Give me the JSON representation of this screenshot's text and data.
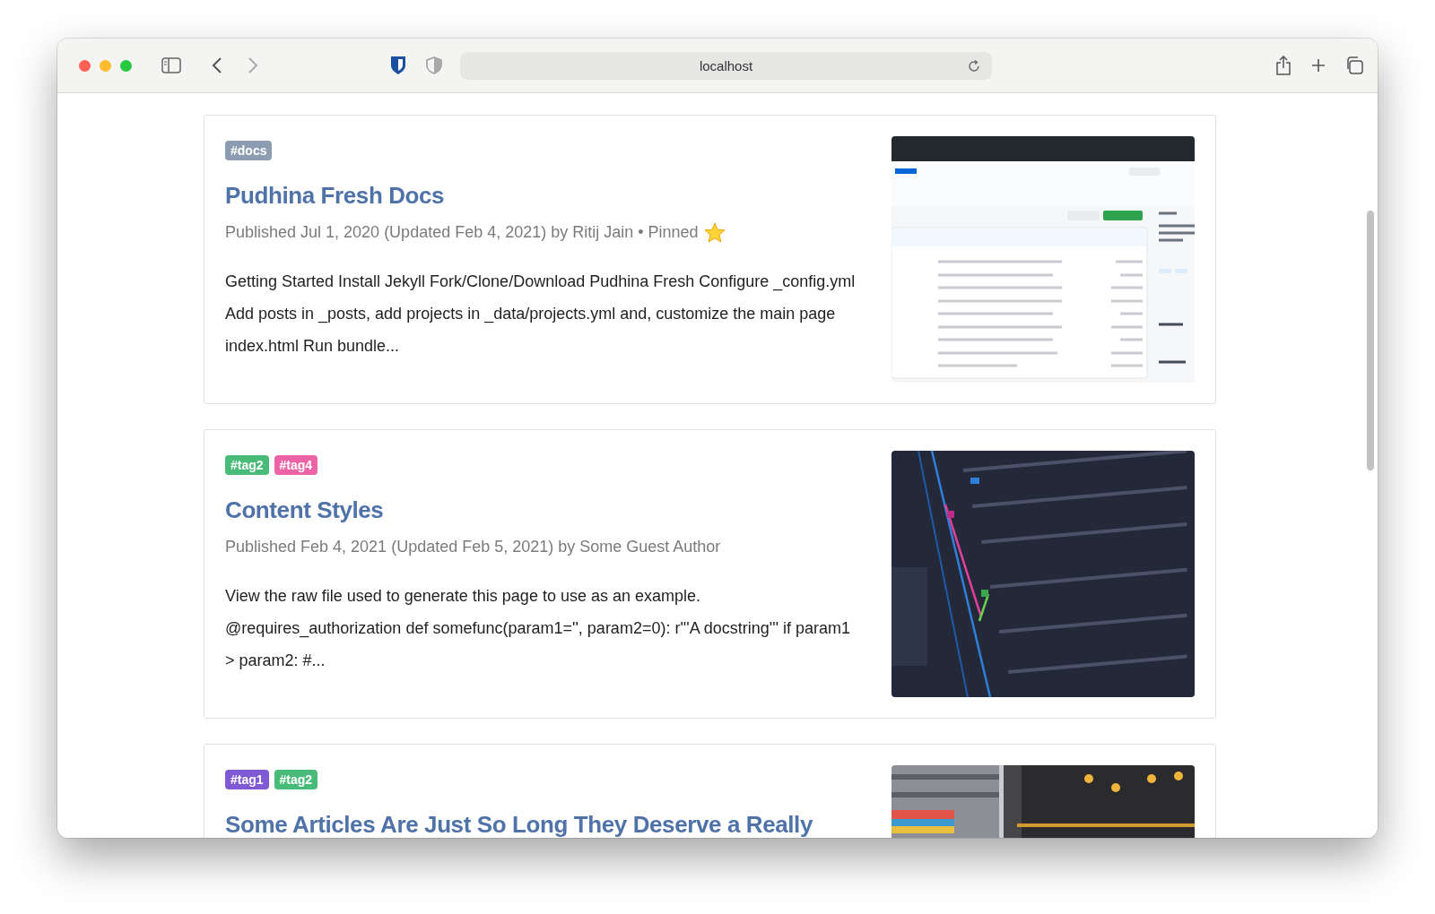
{
  "browser": {
    "url": "localhost"
  },
  "posts": [
    {
      "tags": [
        {
          "label": "#docs",
          "color": "#8d9db1"
        }
      ],
      "title": "Pudhina Fresh Docs",
      "meta": "Published Jul 1, 2020 (Updated Feb 4, 2021) by Ritij Jain • Pinned",
      "pinned": true,
      "excerpt": "Getting Started Install Jekyll Fork/Clone/Download Pudhina Fresh Configure _config.yml Add posts in _posts, add projects in _data/projects.yml and, customize the main page index.html Run bundle...",
      "image": {
        "kind": "picture"
      }
    },
    {
      "tags": [
        {
          "label": "#tag2",
          "color": "#48bb78"
        },
        {
          "label": "#tag4",
          "color": "#ed64a6"
        }
      ],
      "title": "Content Styles",
      "meta": "Published Feb 4, 2021 (Updated Feb 5, 2021) by Some Guest Author",
      "pinned": false,
      "excerpt": "View the raw file used to generate this page to use as an example. @requires_authorization def somefunc(param1='', param2=0): r'''A docstring''' if param1 > param2: #...",
      "image": {
        "kind": "picture"
      }
    },
    {
      "tags": [
        {
          "label": "#tag1",
          "color": "#805ad5"
        },
        {
          "label": "#tag2",
          "color": "#48bb78"
        }
      ],
      "title": "Some Articles Are Just So Long They Deserve a Really",
      "image": {
        "kind": "picture"
      }
    }
  ]
}
